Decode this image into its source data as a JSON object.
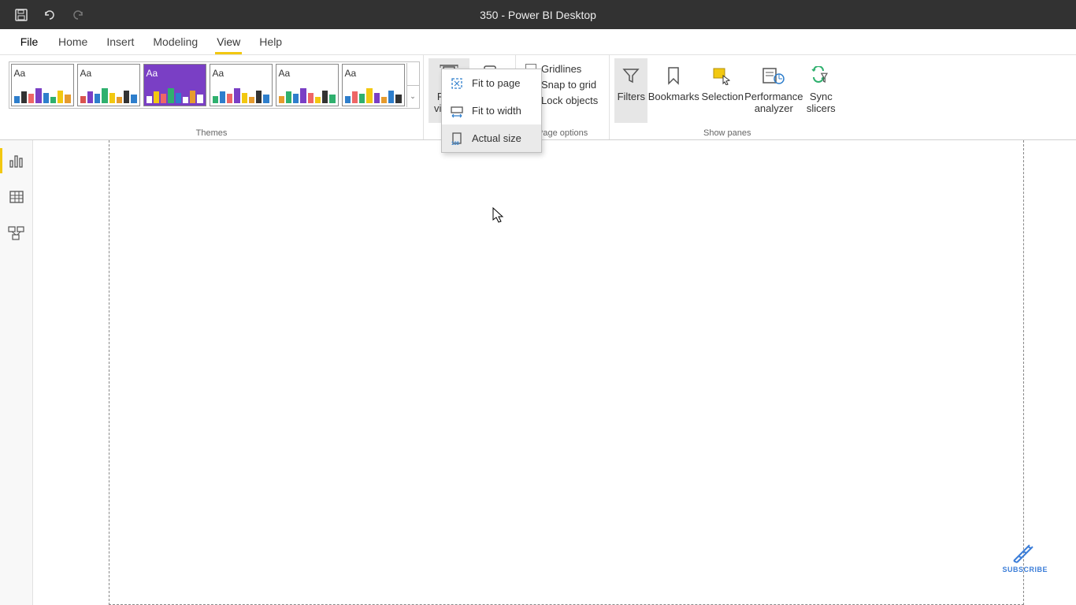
{
  "app_title": "350 - Power BI Desktop",
  "tabs": {
    "file": "File",
    "home": "Home",
    "insert": "Insert",
    "modeling": "Modeling",
    "view": "View",
    "help": "Help"
  },
  "groups": {
    "themes": "Themes",
    "page_options": "Page options",
    "show_panes": "Show panes"
  },
  "buttons": {
    "page_view": "Page view",
    "mobile_layout": "Mobile layout",
    "filters": "Filters",
    "bookmarks": "Bookmarks",
    "selection": "Selection",
    "performance": "Performance analyzer",
    "sync_slicers": "Sync slicers"
  },
  "page_options": {
    "gridlines": "Gridlines",
    "snap": "Snap to grid",
    "lock": "Lock objects"
  },
  "page_view_menu": {
    "fit_page": "Fit to page",
    "fit_width": "Fit to width",
    "actual_size": "Actual size"
  },
  "icons": {
    "save": "save-icon",
    "undo": "undo-icon",
    "redo": "redo-icon",
    "report": "report-view-icon",
    "data": "data-view-icon",
    "model": "model-view-icon"
  },
  "subscribe": "SUBSCRIBE",
  "theme_label": "Aa",
  "dropdown_caret": "⌄"
}
